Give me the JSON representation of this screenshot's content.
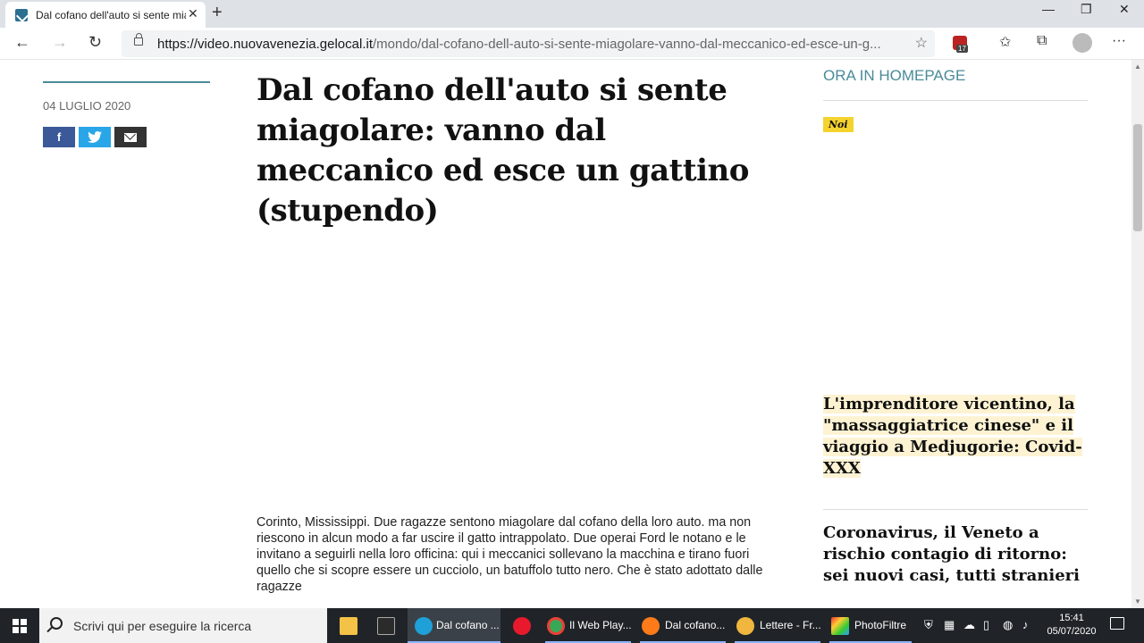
{
  "browser": {
    "tab_title": "Dal cofano dell'auto si sente mia",
    "tab_close": "✕",
    "new_tab": "+",
    "url_domain": "https://video.nuovavenezia.gelocal.it",
    "url_path": "/mondo/dal-cofano-dell-auto-si-sente-miagolare-vanno-dal-meccanico-ed-esce-un-g...",
    "extension_badge_count": "17",
    "window_controls": {
      "minimize": "—",
      "maximize": "❐",
      "close": "✕"
    },
    "nav": {
      "back": "←",
      "forward": "→",
      "refresh": "↻",
      "favorite": "☆",
      "favorites_bar": "✩",
      "collections": "⧉",
      "more": "···"
    }
  },
  "article": {
    "date": "04 LUGLIO 2020",
    "share": {
      "facebook": "f",
      "twitter": "t"
    },
    "headline": "Dal cofano dell'auto si sente miagolare: vanno dal meccanico ed esce un gattino (stupendo)",
    "body": "Corinto, Mississippi. Due ragazze sentono miagolare dal cofano della loro auto. ma non riescono in alcun modo a far uscire il gatto intrappolato. Due operai Ford le notano e le invitano a seguirli  nella loro officina: qui i meccanici sollevano la macchina e tirano fuori quello che si scopre essere un cucciolo, un batuffolo tutto nero. Che è stato adottato dalle ragazze"
  },
  "sidebar": {
    "section_title": "ORA IN HOMEPAGE",
    "noi_badge": "Noi",
    "news": [
      {
        "title": "L'imprenditore vicentino, la \"massaggiatrice cinese\" e il viaggio a Medjugorie: Covid-XXX"
      },
      {
        "title": "Coronavirus, il Veneto a rischio contagio di ritorno: sei nuovi casi, tutti stranieri"
      }
    ]
  },
  "taskbar": {
    "search_placeholder": "Scrivi qui per eseguire la ricerca",
    "apps": [
      {
        "label": "",
        "icon": "file-explorer-icon",
        "color": "#f3c246"
      },
      {
        "label": "",
        "icon": "terminal-icon",
        "color": "#2b2b2b"
      },
      {
        "label": "Dal cofano ...",
        "icon": "edge-icon",
        "color": "#1fa0d8"
      },
      {
        "label": "",
        "icon": "opera-icon",
        "color": "#e8192c"
      },
      {
        "label": "Il Web Play...",
        "icon": "chrome-icon",
        "color": "#3aa757"
      },
      {
        "label": "Dal cofano...",
        "icon": "firefox-icon",
        "color": "#ff7b1a"
      },
      {
        "label": "Lettere - Fr...",
        "icon": "mail-app-icon",
        "color": "#f0b63e"
      },
      {
        "label": "PhotoFiltre",
        "icon": "photofiltre-icon",
        "color": "#6bbd3a"
      }
    ],
    "clock_time": "15:41",
    "clock_date": "05/07/2020"
  }
}
